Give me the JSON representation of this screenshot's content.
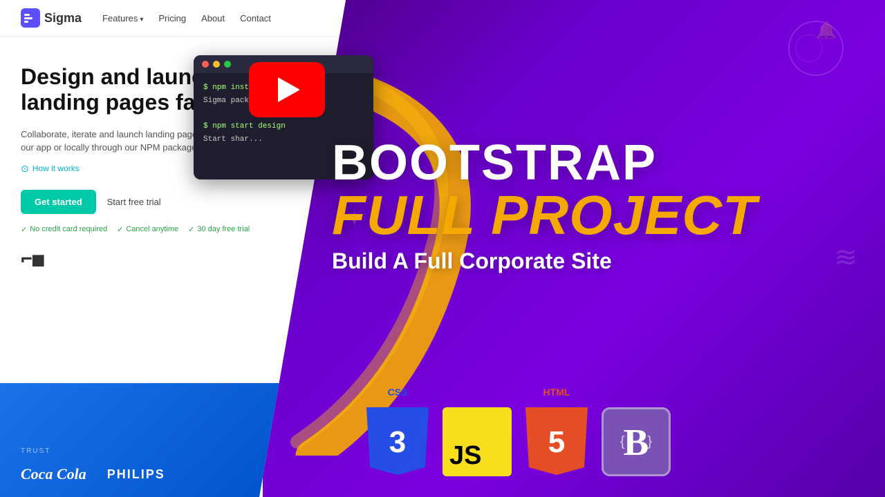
{
  "navbar": {
    "logo_text": "Sigma",
    "nav_items": [
      {
        "label": "Features",
        "has_dropdown": true
      },
      {
        "label": "Pricing",
        "has_dropdown": false
      },
      {
        "label": "About",
        "has_dropdown": false
      },
      {
        "label": "Contact",
        "has_dropdown": false
      }
    ]
  },
  "hero": {
    "headline": "Design and launch landing pages faster.",
    "subtext": "Collaborate, iterate and launch landing pages through our app or locally through our NPM package.",
    "how_it_works": "How it works",
    "cta_primary": "Get started",
    "cta_secondary": "Start free trial",
    "badges": [
      "No credit card required",
      "Cancel anytime",
      "30 day free trial"
    ]
  },
  "terminal": {
    "lines": [
      "$ npm install sigma",
      "Sigma package installed 👍",
      "",
      "$ npm start design",
      "Start shar..."
    ]
  },
  "trusted": {
    "label": "TRUST",
    "brands": [
      "Coca Cola",
      "PHILIPS"
    ]
  },
  "overlay": {
    "line1": "BOOTSTRAP",
    "line2": "FULL PROJECT",
    "line3": "Build A Full Corporate Site"
  },
  "tech_icons": [
    {
      "name": "CSS",
      "label": "CSS"
    },
    {
      "name": "JS",
      "label": ""
    },
    {
      "name": "HTML",
      "label": "HTML"
    },
    {
      "name": "Bootstrap",
      "label": ""
    }
  ],
  "colors": {
    "accent_teal": "#00c9a7",
    "purple_dark": "#4a0080",
    "gold": "#f5a800",
    "blue_nav": "#1a73e8"
  }
}
